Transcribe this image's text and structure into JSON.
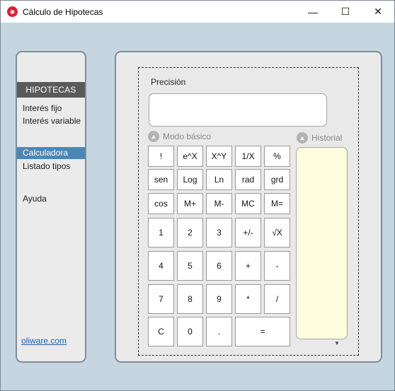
{
  "window": {
    "title": "Cálculo de Hipotecas",
    "controls": {
      "minimize": "—",
      "maximize": "☐",
      "close": "✕"
    }
  },
  "sidebar": {
    "header": "HIPOTECAS",
    "items": [
      {
        "label": "Interés fijo"
      },
      {
        "label": "Interés variable"
      },
      {
        "label": "Calculadora",
        "active": true
      },
      {
        "label": "Listado tipos"
      },
      {
        "label": "Ayuda"
      }
    ],
    "footer_link": "oliware.com"
  },
  "calculator": {
    "precision_label": "Precisión",
    "precision_value": "",
    "mode_label": "Modo básico",
    "history_label": "Historial",
    "keys": {
      "fact": "!",
      "exp": "e^X",
      "pow": "X^Y",
      "inv": "1/X",
      "pct": "%",
      "sen": "sen",
      "log": "Log",
      "ln": "Ln",
      "rad": "rad",
      "grd": "grd",
      "cos": "cos",
      "mplus": "M+",
      "mminus": "M-",
      "mc": "MC",
      "meq": "M=",
      "d1": "1",
      "d2": "2",
      "d3": "3",
      "neg": "+/-",
      "sqrt": "√X",
      "d4": "4",
      "d5": "5",
      "d6": "6",
      "add": "+",
      "sub": "-",
      "d7": "7",
      "d8": "8",
      "d9": "9",
      "mul": "*",
      "div": "/",
      "clear": "C",
      "d0": "0",
      "dot": ".",
      "eq": "="
    }
  },
  "colors": {
    "accent": "#4a86b8",
    "background": "#c5d6e0",
    "history_bg": "#fffde0"
  }
}
